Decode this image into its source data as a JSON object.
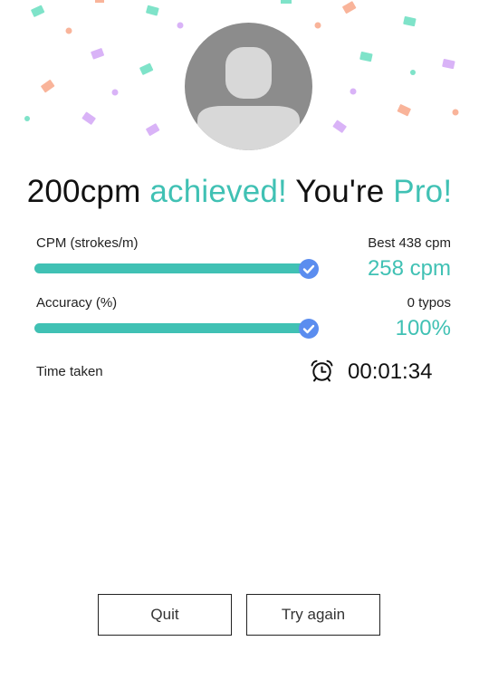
{
  "colors": {
    "accent": "#40c1b4",
    "check": "#5b8def",
    "avatar_bg": "#8c8c8c",
    "confetti_mint": "#7fe3c9",
    "confetti_peach": "#f9b49a",
    "confetti_lilac": "#d9b3f7"
  },
  "headline": {
    "part1": "200cpm ",
    "part2": "achieved!",
    "part3": " You're ",
    "part4": "Pro!"
  },
  "stats": {
    "cpm": {
      "label": "CPM (strokes/m)",
      "best": "Best 438 cpm",
      "value": "258 cpm",
      "progress_percent": 100,
      "icon": "check-circle-icon"
    },
    "accuracy": {
      "label": "Accuracy (%)",
      "typos": "0 typos",
      "value": "100%",
      "progress_percent": 100,
      "icon": "check-circle-icon"
    },
    "time": {
      "label": "Time taken",
      "value": "00:01:34",
      "icon": "alarm-clock-icon"
    }
  },
  "buttons": {
    "quit": "Quit",
    "try_again": "Try again"
  }
}
